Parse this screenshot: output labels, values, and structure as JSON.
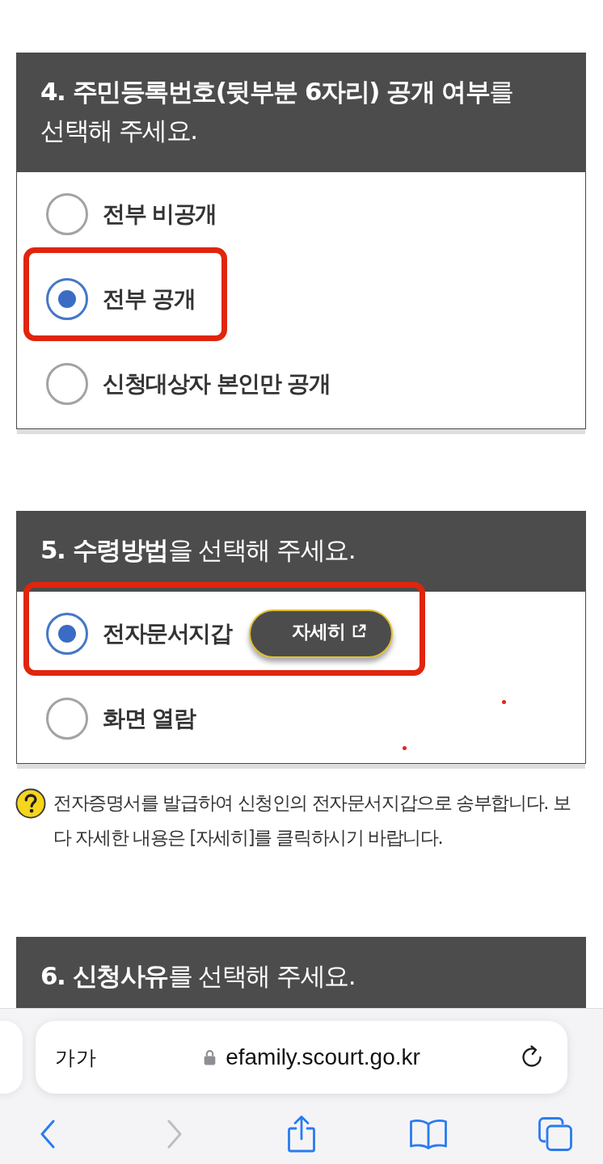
{
  "questions": [
    {
      "title": "**4. 주민등록번호(뒷부분 6자리) 공개 여부**를 선택해 주세요.",
      "options": [
        {
          "label": "전부 비공개",
          "selected": false,
          "highlighted": false
        },
        {
          "label": "전부 공개",
          "selected": true,
          "highlighted": true
        },
        {
          "label": "신청대상자 본인만 공개",
          "selected": false,
          "highlighted": false
        }
      ]
    },
    {
      "title": "**5. 수령방법**을 선택해 주세요.",
      "options": [
        {
          "label": "전자문서지갑",
          "selected": true,
          "highlighted": true,
          "button": "자세히"
        },
        {
          "label": "화면 열람",
          "selected": false,
          "highlighted": false
        }
      ],
      "help": "전자증명서를 발급하여 신청인의 전자문서지갑으로 송부합니다. 보다 자세한 내용은 [자세히]를 클릭하시기 바랍니다."
    },
    {
      "title": "**6. 신청사유**를 선택해 주세요."
    }
  ],
  "browser": {
    "text_size_button": "가가",
    "url": "efamily.scourt.go.kr",
    "toolbar": [
      {
        "kind": "back",
        "disabled": false
      },
      {
        "kind": "forward",
        "disabled": true
      },
      {
        "kind": "share",
        "disabled": false
      },
      {
        "kind": "bookmarks",
        "disabled": false
      },
      {
        "kind": "tabs",
        "disabled": false
      }
    ]
  }
}
